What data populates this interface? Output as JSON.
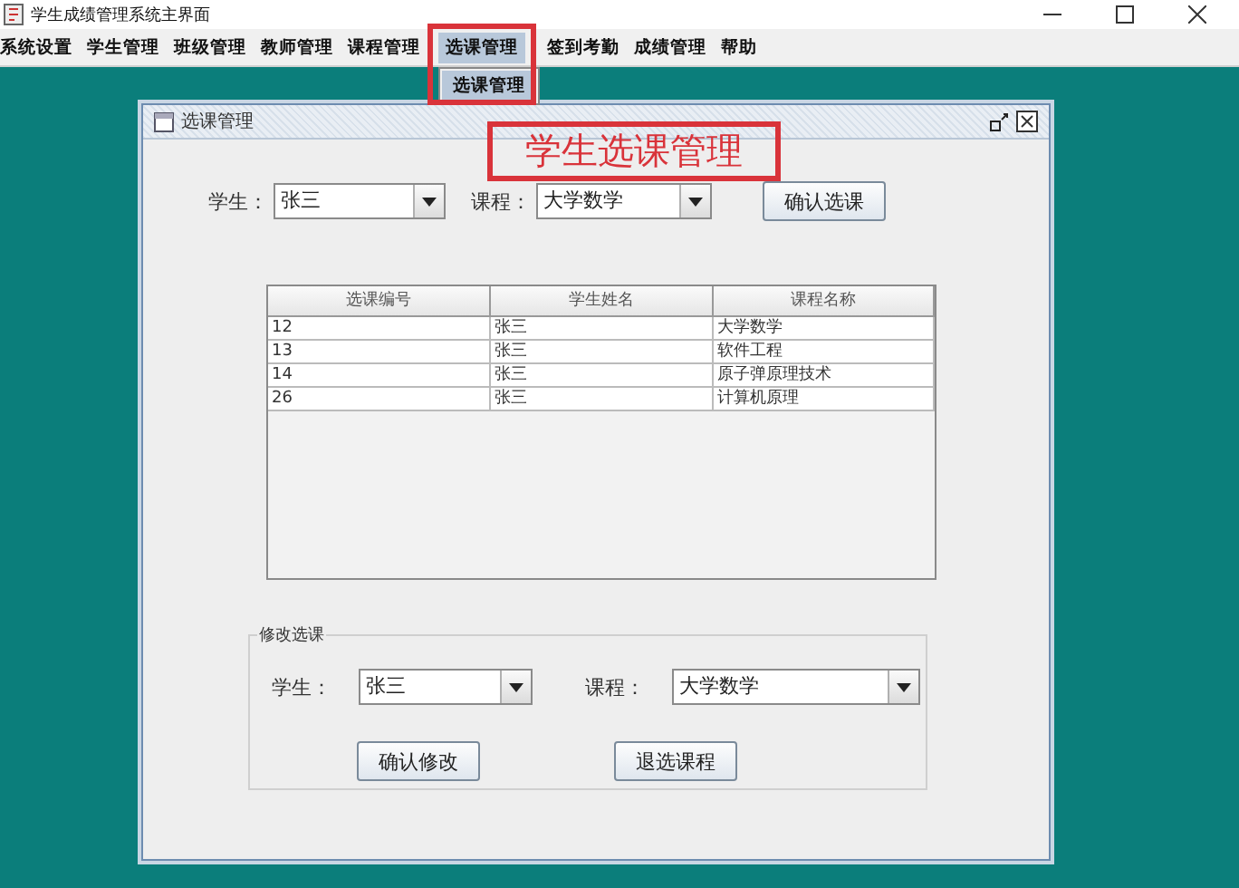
{
  "window": {
    "title": "学生成绩管理系统主界面"
  },
  "menu": [
    {
      "label": "系统设置",
      "selected": false
    },
    {
      "label": "学生管理",
      "selected": false
    },
    {
      "label": "班级管理",
      "selected": false
    },
    {
      "label": "教师管理",
      "selected": false
    },
    {
      "label": "课程管理",
      "selected": false
    },
    {
      "label": "选课管理",
      "selected": true
    },
    {
      "label": "签到考勤",
      "selected": false
    },
    {
      "label": "成绩管理",
      "selected": false
    },
    {
      "label": "帮助",
      "selected": false
    }
  ],
  "dropdown": {
    "items": [
      {
        "label": "选课管理",
        "selected": true
      }
    ]
  },
  "annotation": {
    "label": "学生选课管理"
  },
  "frame": {
    "title": "选课管理"
  },
  "select_form": {
    "student_label": "学生：",
    "student": "张三",
    "course_label": "课程：",
    "course": "大学数学",
    "button": "确认选课"
  },
  "table": {
    "columns": [
      "选课编号",
      "学生姓名",
      "课程名称"
    ],
    "rows": [
      [
        "12",
        "张三",
        "大学数学"
      ],
      [
        "13",
        "张三",
        "软件工程"
      ],
      [
        "14",
        "张三",
        "原子弹原理技术"
      ],
      [
        "26",
        "张三",
        "计算机原理"
      ]
    ]
  },
  "edit_group": {
    "title": "修改选课",
    "student_label": "学生：",
    "student": "张三",
    "course_label": "课程：",
    "course": "大学数学",
    "buttons": [
      "确认修改",
      "退选课程"
    ]
  }
}
